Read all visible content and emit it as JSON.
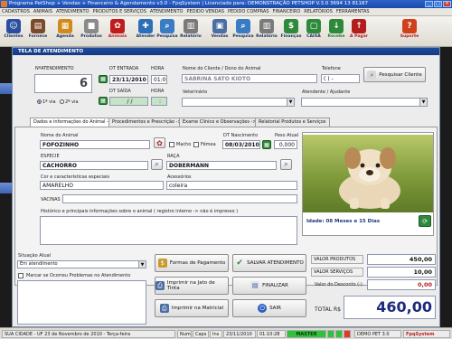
{
  "window": {
    "title": "Programa PetShop + Vendas + Financeiro & Agendamento v3.0 - FpqSystem | Licenciado para: DEMONSTRAÇÃO PETSHOP V.3.0  3694 13 81187"
  },
  "menu": [
    "CADASTROS",
    "ANIMAIS",
    "ATENDIMENTO",
    "PRODUTOS E SERVIÇOS",
    "ATENDIMENTO",
    "PEDIDO VENDAS",
    "PEDIDO COMPRAS",
    "FINANCEIRO",
    "RELATÓRIOS",
    "FERRAMENTAS"
  ],
  "toolbar": [
    {
      "label": "Clientes",
      "icon": "clients-icon",
      "color": "#2a4fa0",
      "style": ""
    },
    {
      "label": "Fornece",
      "icon": "supplier-icon",
      "color": "#7b4a2a",
      "style": ""
    },
    {
      "label": "Agenda",
      "icon": "agenda-icon",
      "color": "#d08a1a",
      "style": ""
    },
    {
      "label": "Produtos",
      "icon": "products-icon",
      "color": "#8a8a8a",
      "style": ""
    },
    {
      "label": "Animais",
      "icon": "paw-icon",
      "color": "#c01c1c",
      "style": "red"
    },
    {
      "label": "Atender",
      "icon": "attend-icon",
      "color": "#2c6fb8",
      "style": ""
    },
    {
      "label": "Pesquisa",
      "icon": "search-icon",
      "color": "#3a7cc4",
      "style": ""
    },
    {
      "label": "Relatório",
      "icon": "report-icon",
      "color": "#7a7a7a",
      "style": ""
    },
    {
      "label": "Vendas",
      "icon": "sales-icon",
      "color": "#4b6ea3",
      "style": ""
    },
    {
      "label": "Pesquisa",
      "icon": "search-icon",
      "color": "#3a7cc4",
      "style": ""
    },
    {
      "label": "Relatório",
      "icon": "report-icon",
      "color": "#7a7a7a",
      "style": ""
    },
    {
      "label": "Finanças",
      "icon": "finance-icon",
      "color": "#2e8a3a",
      "style": ""
    },
    {
      "label": "CAIXA",
      "icon": "cash-icon",
      "color": "#2e8a3a",
      "style": ""
    },
    {
      "label": "Recebe",
      "icon": "receive-icon",
      "color": "#2e8a3a",
      "style": "green"
    },
    {
      "label": "A Pagar",
      "icon": "pay-icon",
      "color": "#b31d1d",
      "style": "red"
    },
    {
      "label": "Suporte",
      "icon": "support-icon",
      "color": "#d0401a",
      "style": "red"
    }
  ],
  "form": {
    "header": "TELA DE ATENDIMENTO",
    "atendimento_label": "NºATENDIMENTO",
    "atendimento_value": "6",
    "via1": "1ª via",
    "via2": "2ª via",
    "dt_entrada_label": "DT ENTRADA",
    "dt_entrada": "23/11/2010",
    "hora_label": "HORA",
    "hora_entrada": "01:09",
    "dt_saida_label": "DT SAÍDA",
    "dt_saida": "/ /",
    "hora_saida_label": "HORA",
    "hora_saida": ":",
    "cliente_label": "Nome do Cliente / Dono do Animal",
    "cliente": "SABRINA SATO KIOTO",
    "telefone_label": "Telefone",
    "telefone": "(  )  -",
    "pesquisar_cliente": "Pesquisar Cliente",
    "veterinario_label": "Veterinário",
    "veterinario": "",
    "atendente_label": "Atendente / Ajudante",
    "atendente": ""
  },
  "tabs": [
    "Dados e informações do Animal ->",
    "Procedimentos e Prescrição ->",
    "Exame Clínico e Observações ->",
    "Relatorial Produtos e Serviços"
  ],
  "animal": {
    "nome_label": "Nome do Animal",
    "nome": "FOFOZINHO",
    "macho": "Macho",
    "femea": "Fêmea",
    "dt_nasc_label": "DT Nascimento",
    "dt_nasc": "08/03/2010",
    "peso_label": "Peso Atual",
    "peso": "0,000",
    "especie_label": "ESPECIE",
    "especie": "CACHORRO",
    "raca_label": "RAÇA",
    "raca": "DOBERMANN",
    "cor_label": "Cor e características especiais",
    "cor": "AMARELHO",
    "acessorios_label": "Acessórios",
    "acessorios": "coleira",
    "vacinas_label": "VACINAS",
    "vacinas": "",
    "historico_label": "Histórico e principais informações sobre o animal ( registro interno -> não é impresso )",
    "historico": "",
    "idade": "Idade: 08 Meses e 15 Dias"
  },
  "bottom": {
    "situacao_label": "Situação Atual",
    "situacao": "Em atendimento",
    "marcar_problemas": "Marcar se Ocorreu Problemas no Atendimento",
    "formas_pagamento": "Formas de Pagamento",
    "salvar": "SALVAR ATENDIMENTO",
    "imprimir_jato": "Imprimir na Jato de Tinta",
    "finalizar": "FINALIZAR",
    "imprimir_matricial": "Imprimir na Matricial",
    "sair": "SAIR",
    "valor_produtos_label": "VALOR PRODUTOS",
    "valor_produtos": "450,00",
    "valor_servicos_label": "VALOR SERVIÇOS",
    "valor_servicos": "10,00",
    "desconto_label": "Valor do Desconto (-)",
    "desconto": "0,00",
    "total_label": "TOTAL R$",
    "total": "460,00"
  },
  "status": {
    "cidade": "SUA CIDADE - UF 23 de Novembro de 2010 - Terça-feira",
    "num": "Num",
    "caps": "Caps",
    "ins": "Ins",
    "date": "23/11/2010",
    "time": "01:10:28",
    "master": "MASTER",
    "version": "DEMO PET 3.0",
    "brand": "FpqSystem"
  },
  "colors": {
    "accent": "#1e4a9e",
    "brand_red": "#b31d1d",
    "total_blue": "#1d2a7a"
  }
}
